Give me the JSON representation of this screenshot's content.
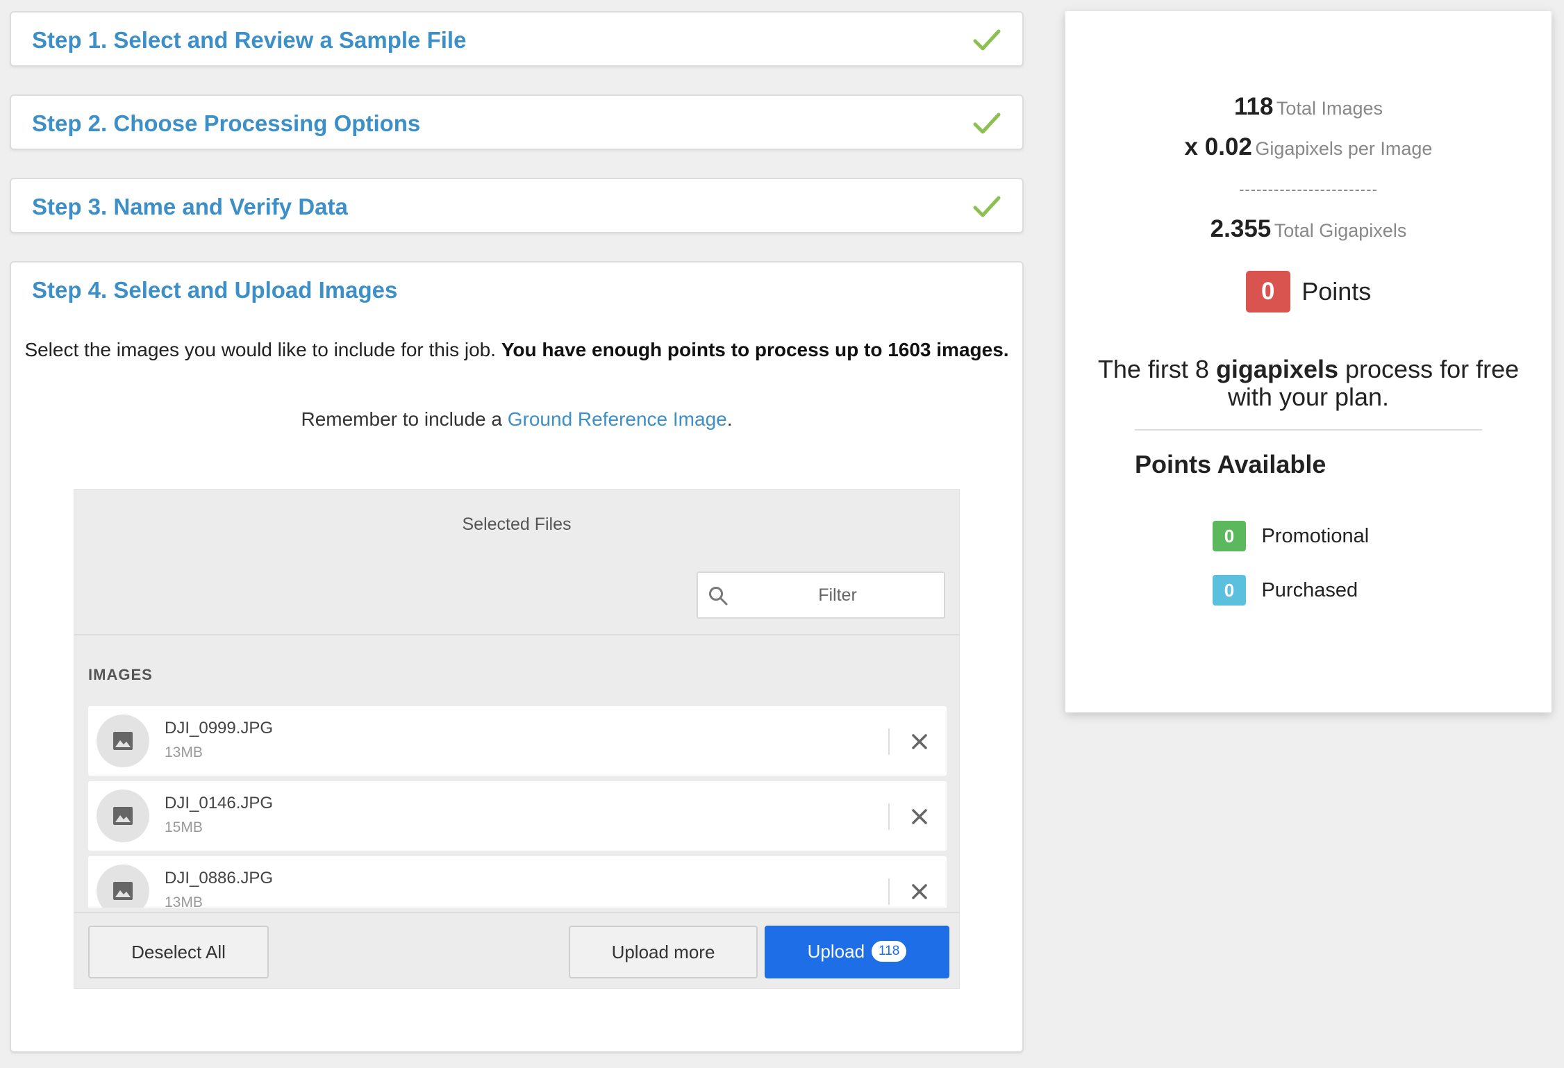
{
  "steps": {
    "step1": "Step 1. Select and Review a Sample File",
    "step2": "Step 2. Choose Processing Options",
    "step3": "Step 3. Name and Verify Data",
    "step4": "Step 4. Select and Upload Images"
  },
  "step4": {
    "intro_text": "Select the images you would like to include for this job.",
    "intro_bold": "You have enough points to process up to 1603 images.",
    "reminder_prefix": "Remember to include a",
    "reminder_link": "Ground Reference Image",
    "reminder_suffix": ".",
    "panel_title": "Selected Files",
    "filter_placeholder": "Filter",
    "images_label": "IMAGES",
    "files": [
      {
        "name": "DJI_0999.JPG",
        "size": "13MB"
      },
      {
        "name": "DJI_0146.JPG",
        "size": "15MB"
      },
      {
        "name": "DJI_0886.JPG",
        "size": "13MB"
      }
    ],
    "deselect_label": "Deselect All",
    "upload_more_label": "Upload more",
    "upload_label": "Upload",
    "upload_count": "118"
  },
  "summary": {
    "total_images": "118",
    "total_images_label": "Total Images",
    "gp_per_image": "x 0.02",
    "gp_per_image_label": "Gigapixels per Image",
    "divider": "------------------------",
    "total_gp": "2.355",
    "total_gp_label": "Total Gigapixels",
    "points_value": "0",
    "points_label": "Points",
    "free_note_1": "The first 8",
    "free_note_bold": "gigapixels",
    "free_note_2": "process for free with your plan.",
    "available_title": "Points Available",
    "promotional_value": "0",
    "promotional_label": "Promotional",
    "purchased_value": "0",
    "purchased_label": "Purchased"
  },
  "colors": {
    "accent": "#3d8fc7",
    "check": "#8cc152",
    "points_badge": "#d9534f",
    "promotional_badge": "#5cb85c",
    "purchased_badge": "#5bc0de",
    "upload_button": "#1e6ee8"
  },
  "icons": {
    "complete": "check-icon",
    "search": "search-icon",
    "thumbnail": "image-icon",
    "remove": "close-icon"
  }
}
